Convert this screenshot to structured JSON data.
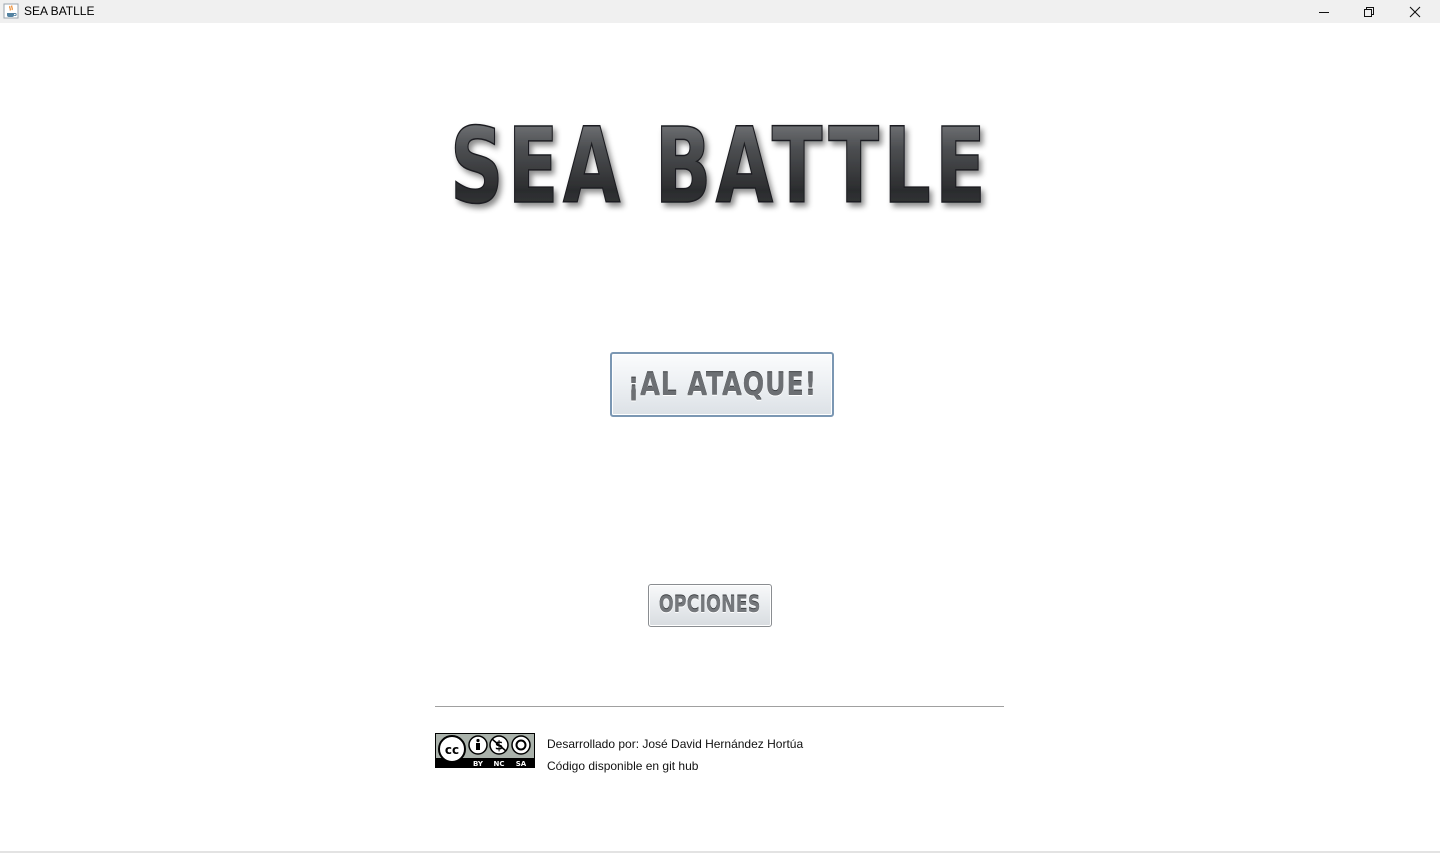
{
  "window": {
    "title": "SEA BATLLE",
    "app_icon": "java-coffee-icon",
    "controls": [
      "minimize-icon",
      "maximize-icon",
      "close-icon"
    ]
  },
  "logo": {
    "text": "SEA BATTLE"
  },
  "menu": {
    "attack_label": "¡AL ATAQUE!",
    "options_label": "OPCIONES"
  },
  "footer": {
    "license_badge": {
      "icon": "creative-commons-by-nc-sa-icon",
      "labels": [
        "BY",
        "NC",
        "SA"
      ]
    },
    "developer": "Desarrollado por: José David Hernández Hortúa",
    "source": "Código disponible en git hub"
  },
  "colors": {
    "attack_border": "#7b97b3",
    "text_metal": "#6c6f73",
    "logo_dark": "#2e2f31"
  }
}
